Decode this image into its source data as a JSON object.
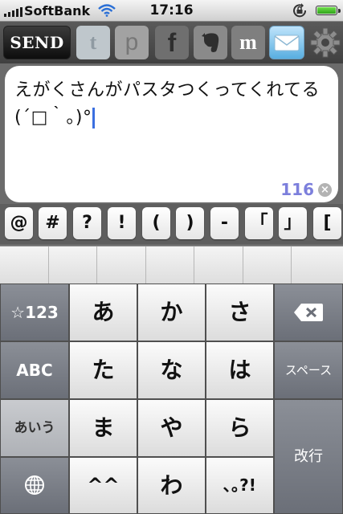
{
  "status_bar": {
    "carrier": "SoftBank",
    "time": "17:16",
    "icons": [
      "signal-bars-icon",
      "wifi-icon",
      "orientation-lock-icon",
      "battery-icon"
    ]
  },
  "toolbar": {
    "send_label": "SEND",
    "services": [
      {
        "name": "twitter",
        "glyph": "t",
        "enabled": false
      },
      {
        "name": "plurk",
        "glyph": "p",
        "enabled": false
      },
      {
        "name": "facebook",
        "glyph": "f",
        "enabled": false
      },
      {
        "name": "evernote",
        "glyph": "evernote-elephant-icon",
        "enabled": false
      },
      {
        "name": "mixi",
        "glyph": "m",
        "enabled": false
      },
      {
        "name": "mail",
        "glyph": "envelope-icon",
        "enabled": true
      }
    ],
    "settings_icon": "gear-icon"
  },
  "compose": {
    "text": "えがくさんがパスタつくってくれてる(´□｀。)°",
    "remaining": "116"
  },
  "symbols": [
    "@",
    "#",
    "?",
    "!",
    "(",
    ")",
    "-",
    "「",
    "」",
    "["
  ],
  "keyboard": {
    "row1": {
      "left": "☆123",
      "keys": [
        "あ",
        "か",
        "さ"
      ]
    },
    "row2": {
      "left": "ABC",
      "keys": [
        "た",
        "な",
        "は"
      ],
      "right": "スペース"
    },
    "row3": {
      "left": "あいう",
      "keys": [
        "ま",
        "や",
        "ら"
      ],
      "right": "改行"
    },
    "row4": {
      "keys": [
        "^^",
        "わ",
        "､｡?!"
      ]
    },
    "icons": [
      "backspace-icon",
      "globe-icon"
    ]
  },
  "colors": {
    "counter": "#7c7fdc",
    "cursor": "#3b6fe0",
    "dark_key": "#6b6f78"
  }
}
